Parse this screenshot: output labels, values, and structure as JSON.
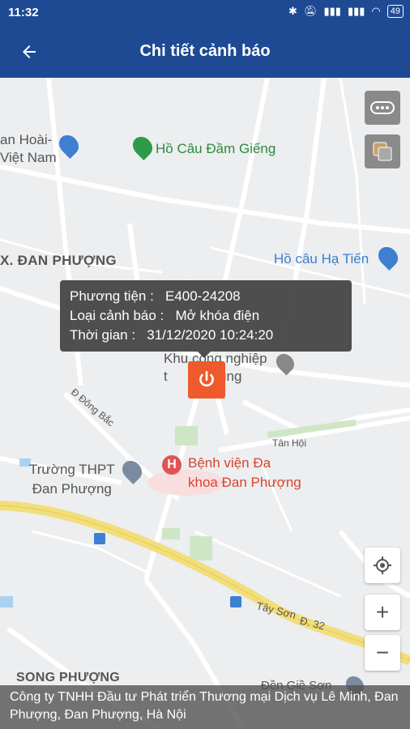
{
  "status_bar": {
    "time": "11:32",
    "battery": "49"
  },
  "app_bar": {
    "title": "Chi tiết cảnh báo",
    "back_icon": "arrow-left-icon"
  },
  "map": {
    "labels": {
      "dan_hoai": "an Hoài-\nViệt Nam",
      "ho_cau_dam_gieng": "Hồ Câu Đầm Giếng",
      "x_dan_phuong": "X. ĐAN PHƯỢNG",
      "ho_cau_ha_tien": "Hồ câu Hạ Tiến",
      "khu_cong_nghiep": "Khu công nghiệp\nt      n Phùng",
      "d_dong_bac": "Đ Đông Bắc",
      "tan_hoi": "Tân Hội",
      "benh_vien": "Bệnh viện Đa\nkhoa Đan Phượng",
      "truong_thpt": "Trường THPT\nĐan Phượng",
      "tay_son": "Tây Sơn",
      "d32": "Đ. 32",
      "song_phuong": "SONG PHƯỢNG",
      "den_gie_son": "Đền Giề Sơn"
    }
  },
  "popup": {
    "vehicle_label": "Phương tiện :",
    "vehicle_value": "E400-24208",
    "alert_type_label": "Loại cảnh báo :",
    "alert_type_value": "Mở khóa điện",
    "time_label": "Thời gian :",
    "time_value": "31/12/2020 10:24:20"
  },
  "controls": {
    "more": "more-icon",
    "layers": "layers-icon",
    "locate": "locate-icon",
    "zoom_in": "+",
    "zoom_out": "−"
  },
  "address": "Công ty TNHH Đầu tư Phát triển Thương mại Dịch vụ Lê Minh, Đan Phượng, Đan Phượng, Hà Nội",
  "colors": {
    "appbar": "#1e4a94",
    "marker": "#ee5a2b",
    "road_major": "#f2de7a"
  }
}
